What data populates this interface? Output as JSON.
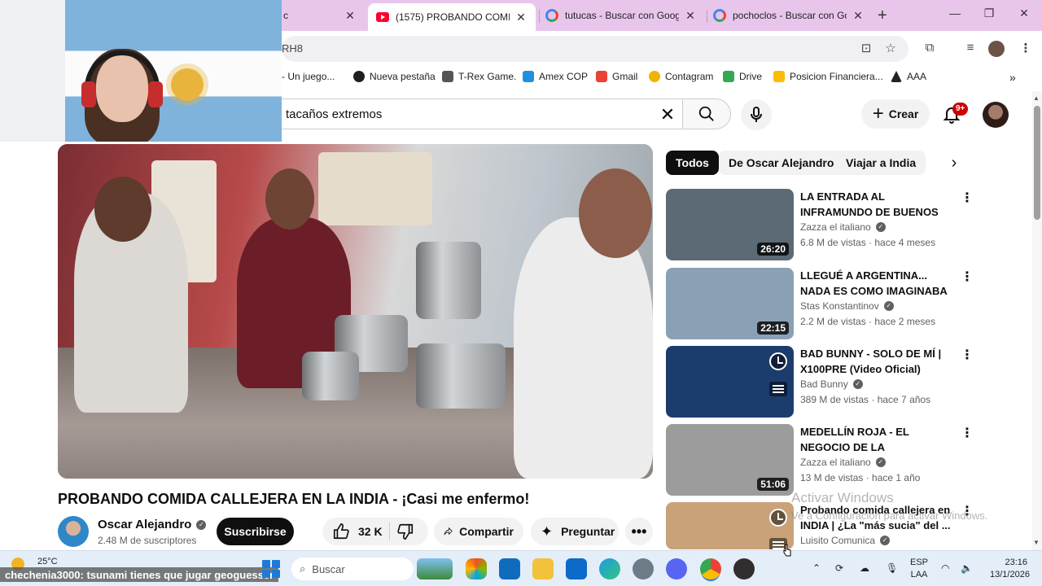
{
  "browser": {
    "tabs": [
      {
        "label": "c"
      },
      {
        "label": "(1575) PROBANDO COMIDA",
        "favicon": "youtube-icon",
        "active": true
      },
      {
        "label": "tutucas - Buscar con Google",
        "favicon": "google-icon"
      },
      {
        "label": "pochoclos - Buscar con Goo",
        "favicon": "google-icon"
      }
    ],
    "address_fragment": "RH8",
    "bookmarks": [
      {
        "label": "- Un juego..."
      },
      {
        "label": "Nueva pestaña",
        "icon": "github-icon"
      },
      {
        "label": "T-Rex Game.",
        "icon": "dino-icon"
      },
      {
        "label": "Amex COP",
        "icon": "amex-icon"
      },
      {
        "label": "Gmail",
        "icon": "gmail-icon"
      },
      {
        "label": "Contagram",
        "icon": "contagram-icon"
      },
      {
        "label": "Drive",
        "icon": "drive-icon"
      },
      {
        "label": "Posicion Financiera...",
        "icon": "drive-icon"
      },
      {
        "label": "AAA",
        "icon": "aaa-icon"
      }
    ]
  },
  "youtube": {
    "search_query": "tacaños extremos",
    "create_label": "Crear",
    "notif_count": "9+",
    "video": {
      "title": "PROBANDO COMIDA CALLEJERA EN LA INDIA - ¡Casi me enfermo!",
      "channel": "Oscar Alejandro",
      "subscribers": "2.48 M de suscriptores",
      "subscribe_label": "Suscribirse",
      "likes": "32 K",
      "share_label": "Compartir",
      "ask_label": "Preguntar"
    },
    "chips": [
      "Todos",
      "De Oscar Alejandro",
      "Viajar a India"
    ],
    "recommendations": [
      {
        "title": "LA ENTRADA AL INFRAMUNDO DE BUENOS AIRES - ¡Aquí NO ...",
        "channel": "Zazza el italiano",
        "meta": "6.8 M de vistas · hace 4 meses",
        "duration": "26:20",
        "thumb_color": "#5b6a74"
      },
      {
        "title": "LLEGUÉ A ARGENTINA... NADA ES COMO IMAGINABA",
        "channel": "Stas Konstantinov",
        "meta": "2.2 M de vistas · hace 2 meses",
        "duration": "22:15",
        "thumb_color": "#8aa0b4"
      },
      {
        "title": "BAD BUNNY - SOLO DE MÍ | X100PRE (Video Oficial)",
        "channel": "Bad Bunny",
        "meta": "389 M de vistas · hace 7 años",
        "duration": "",
        "thumb_color": "#1d3c6e"
      },
      {
        "title": "MEDELLÍN ROJA - EL NEGOCIO DE LA PROSTITUCIÓN co",
        "channel": "Zazza el italiano",
        "meta": "13 M de vistas · hace 1 año",
        "duration": "51:06",
        "thumb_color": "#9c9c9c"
      },
      {
        "title": "Probando comida callejera en INDIA | ¿La \"más sucia\" del ...",
        "channel": "Luisito Comunica",
        "meta": "",
        "duration": "",
        "thumb_color": "#c9a27a"
      }
    ]
  },
  "overlay": {
    "activate_title": "Activar Windows",
    "activate_sub": "Ve a Configuración para activar Windows.",
    "chat_user": "chechenia3000",
    "chat_message": ": tsunami tienes que jugar geoguesser"
  },
  "taskbar": {
    "temperature": "25°C",
    "search_placeholder": "Buscar",
    "lang_line1": "ESP",
    "lang_line2": "LAA",
    "time": "23:16",
    "date": "13/1/2026"
  }
}
